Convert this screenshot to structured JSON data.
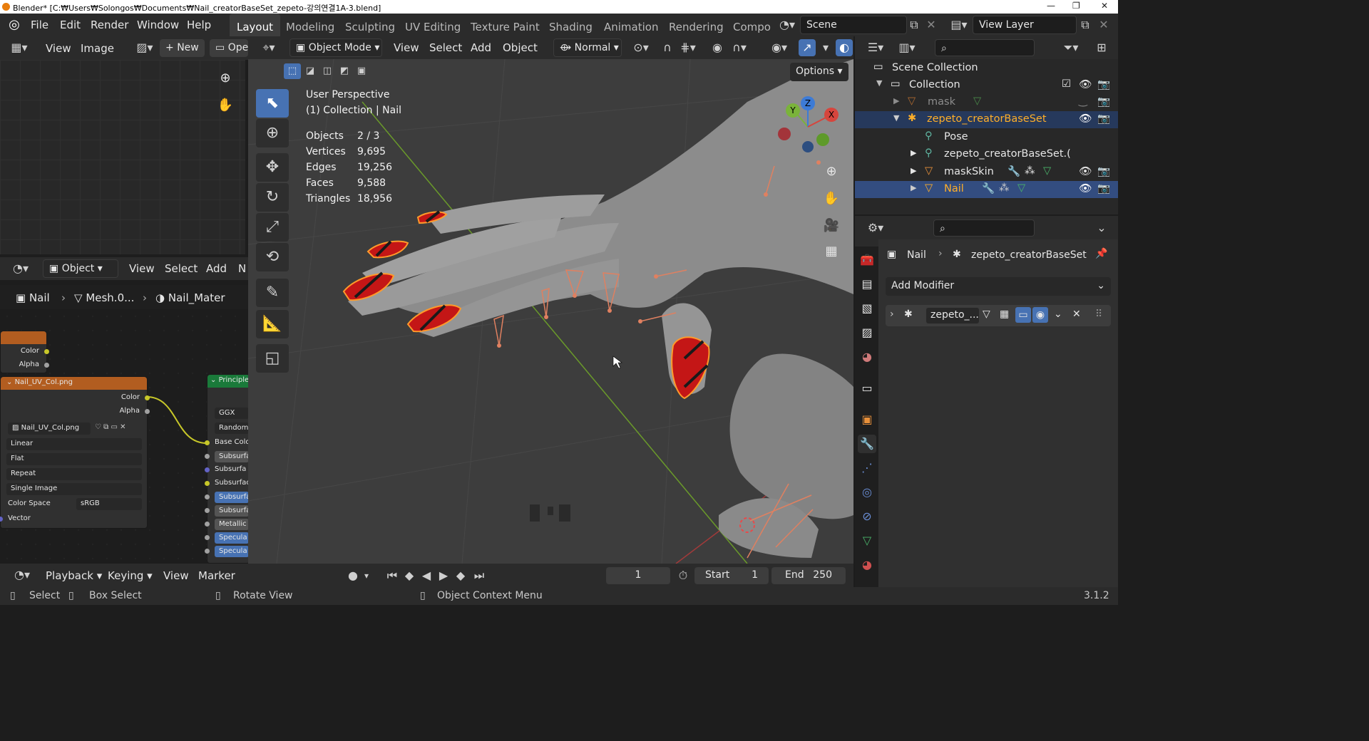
{
  "window": {
    "title": "Blender* [C:₩Users₩Solongos₩Documents₩Nail_creatorBaseSet_zepeto-강의연결1A-3.blend]",
    "controls": [
      "—",
      "❐",
      "✕"
    ]
  },
  "menu": [
    "File",
    "Edit",
    "Render",
    "Window",
    "Help"
  ],
  "workspace_tabs": [
    "Layout",
    "Modeling",
    "Sculpting",
    "UV Editing",
    "Texture Paint",
    "Shading",
    "Animation",
    "Rendering",
    "Compo"
  ],
  "active_tab": "Layout",
  "scene": "Scene",
  "view_layer": "View Layer",
  "image_editor": {
    "menus": [
      "View",
      "Image"
    ],
    "new_label": "New",
    "open_label": "Ope"
  },
  "node_editor": {
    "mode": "Object",
    "menus": [
      "View",
      "Select",
      "Add",
      "N"
    ],
    "breadcrumb": [
      "Nail",
      "Mesh.0...",
      "Nail_Mater"
    ],
    "top_node": {
      "outputs": [
        "Color",
        "Alpha"
      ]
    },
    "image_node": {
      "title": "Nail_UV_Col.png",
      "outputs": [
        "Color",
        "Alpha"
      ],
      "image_name": "Nail_UV_Col.png",
      "interpolation": "Linear",
      "projection": "Flat",
      "extension": "Repeat",
      "source": "Single Image",
      "color_space_label": "Color Space",
      "color_space": "sRGB",
      "vector_label": "Vector"
    },
    "principled_node": {
      "title": "Principle",
      "rows": [
        "GGX",
        "Random",
        "Base Colo",
        "Subsurfa",
        "Subsurfa",
        "Subsurfac",
        "Subsurfa",
        "Subsurfa",
        "Metallic",
        "Specula",
        "Specula"
      ]
    }
  },
  "viewport": {
    "mode": "Object Mode",
    "menus": [
      "View",
      "Select",
      "Add",
      "Object"
    ],
    "orientation": "Normal",
    "options_label": "Options",
    "perspective": "User Perspective",
    "collection_line": "(1) Collection | Nail",
    "stats": [
      {
        "label": "Objects",
        "value": "2 / 3"
      },
      {
        "label": "Vertices",
        "value": "9,695"
      },
      {
        "label": "Edges",
        "value": "19,256"
      },
      {
        "label": "Faces",
        "value": "9,588"
      },
      {
        "label": "Triangles",
        "value": "18,956"
      }
    ],
    "gizmo_axes": [
      "Y",
      "Z",
      "X"
    ]
  },
  "timeline": {
    "menus": [
      "Playback",
      "Keying",
      "View",
      "Marker"
    ],
    "current_frame": "1",
    "start_label": "Start",
    "start": "1",
    "end_label": "End",
    "end": "250"
  },
  "status": {
    "items": [
      "Select",
      "Box Select",
      "Rotate View",
      "Object Context Menu"
    ],
    "version": "3.1.2"
  },
  "outliner": {
    "rows": [
      {
        "label": "Scene Collection",
        "level": 0
      },
      {
        "label": "Collection",
        "level": 1
      },
      {
        "label": "mask",
        "level": 2
      },
      {
        "label": "zepeto_creatorBaseSet",
        "level": 2
      },
      {
        "label": "Pose",
        "level": 3
      },
      {
        "label": "zepeto_creatorBaseSet.(",
        "level": 3
      },
      {
        "label": "maskSkin",
        "level": 3
      },
      {
        "label": "Nail",
        "level": 3
      }
    ]
  },
  "properties": {
    "breadcrumb_object": "Nail",
    "breadcrumb_parent": "zepeto_creatorBaseSet",
    "add_modifier": "Add Modifier",
    "modifier_name": "zepeto_..."
  }
}
